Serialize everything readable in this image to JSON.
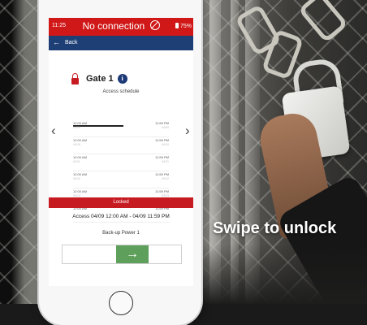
{
  "status_bar": {
    "time": "11:25",
    "connection_text": "No connection",
    "battery": "75%",
    "color": "#d11818"
  },
  "nav": {
    "back_label": "Back",
    "color": "#1e3f75"
  },
  "gate": {
    "title": "Gate 1",
    "info_glyph": "i",
    "lock_icon": "lock-icon"
  },
  "schedule": {
    "title": "Access schedule",
    "rows": [
      {
        "start_time": "12:00 AM",
        "start_date": "04/09",
        "end_time": "11:59 PM",
        "end_date": "04/09"
      },
      {
        "start_time": "12:00 AM",
        "start_date": "04/10",
        "end_time": "11:59 PM",
        "end_date": "04/10"
      },
      {
        "start_time": "12:00 AM",
        "start_date": "04/11",
        "end_time": "11:59 PM",
        "end_date": "04/11"
      },
      {
        "start_time": "12:00 AM",
        "start_date": "04/12",
        "end_time": "11:59 PM",
        "end_date": "04/12"
      },
      {
        "start_time": "12:00 AM",
        "start_date": "04/13",
        "end_time": "11:59 PM",
        "end_date": "04/13"
      },
      {
        "start_time": "12:00 AM",
        "start_date": "",
        "end_time": "11:59 PM",
        "end_date": ""
      }
    ]
  },
  "status": {
    "locked_label": "Locked",
    "locked_color": "#c71b22",
    "access_text": "Access 04/09 12:00 AM - 04/09 11:59 PM",
    "power_text": "Back-up Power 1"
  },
  "slider": {
    "arrow_glyph": "→",
    "color": "#5ea05b"
  },
  "overlay": {
    "swipe_text": "Swipe to unlock"
  }
}
